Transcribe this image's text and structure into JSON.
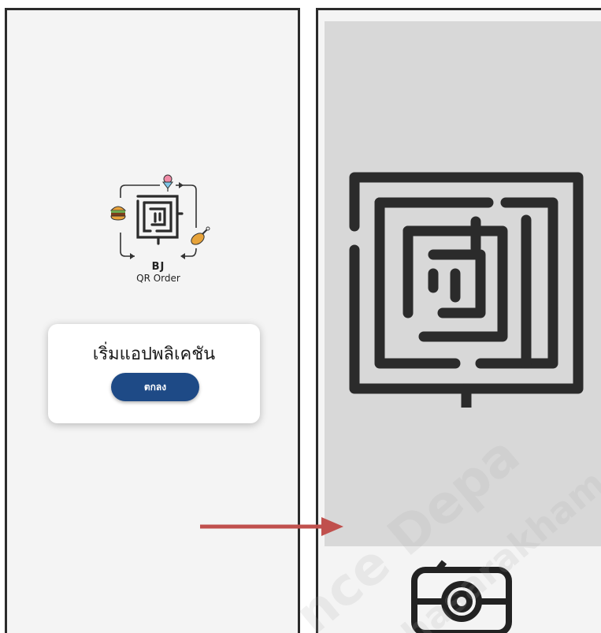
{
  "left_screen": {
    "logo": {
      "brand": "BJ",
      "subtitle": "QR Order",
      "icons": [
        "maze-icon",
        "burger-icon",
        "ice-cream-icon",
        "chicken-leg-icon"
      ]
    },
    "dialog": {
      "title": "เริ่มแอปพลิเคชัน",
      "ok_label": "ตกลง"
    }
  },
  "right_screen": {
    "scan_area_icon": "maze-icon",
    "capture_icon": "camera-icon"
  },
  "watermark": {
    "line1": "nce Depa",
    "line2": "hasarakham U"
  },
  "colors": {
    "button": "#1e4a86",
    "arrow": "#c0504d",
    "scan_area": "#d8d8d8",
    "screen_bg": "#f4f4f4"
  }
}
